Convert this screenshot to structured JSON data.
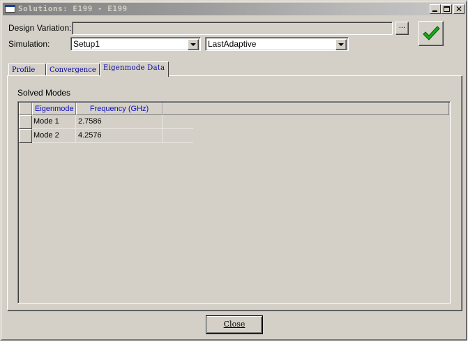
{
  "window": {
    "title": "Solutions: E199 - E199",
    "controls": [
      "minimize-icon",
      "maximize-icon",
      "close-icon"
    ]
  },
  "design_variation": {
    "label": "Design Variation:",
    "value": "",
    "browse_label": "..."
  },
  "simulation": {
    "label": "Simulation:",
    "setup_value": "Setup1",
    "solution_value": "LastAdaptive"
  },
  "apply_button": {
    "icon": "checkmark-icon",
    "color": "#18a818"
  },
  "tabs": [
    {
      "label": "Profile",
      "active": false
    },
    {
      "label": "Convergence",
      "active": false
    },
    {
      "label": "Eigenmode Data",
      "active": true
    }
  ],
  "solved_modes": {
    "label": "Solved Modes",
    "columns": [
      "Eigenmode",
      "Frequency (GHz)"
    ],
    "rows": [
      {
        "mode": "Mode 1",
        "frequency": "2.7586"
      },
      {
        "mode": "Mode 2",
        "frequency": "4.2576"
      }
    ]
  },
  "footer": {
    "close_label": "Close"
  },
  "colors": {
    "face": "#d4d0c8",
    "header_text": "#1010c0",
    "tab_text": "#0000a0"
  }
}
